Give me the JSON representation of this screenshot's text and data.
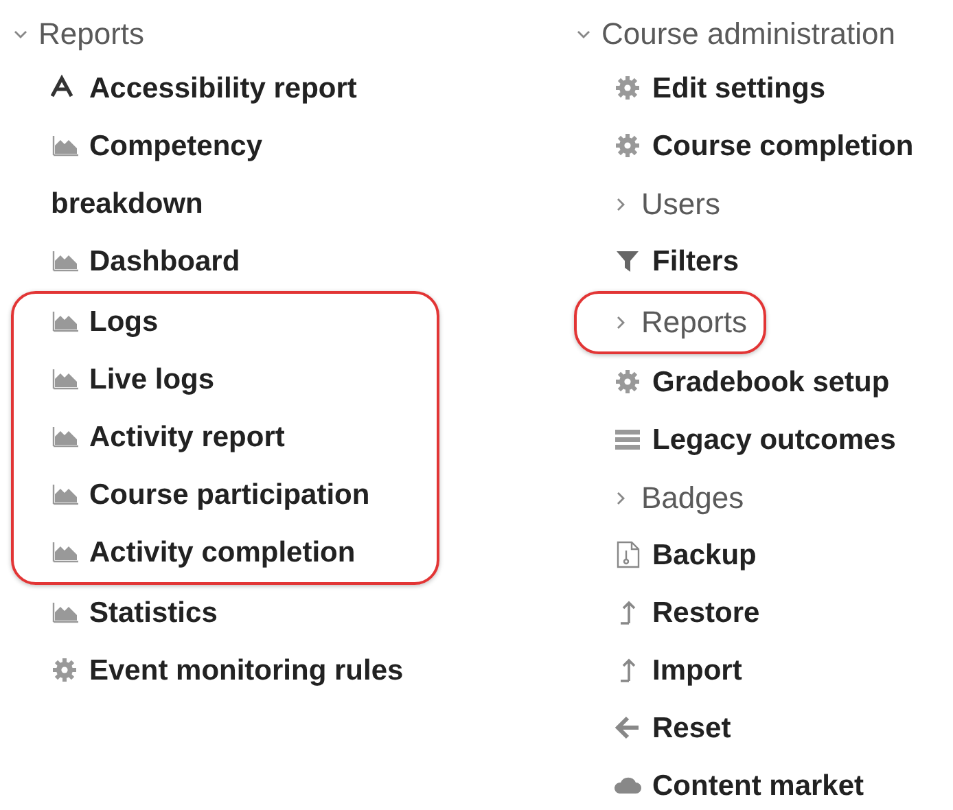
{
  "columns": [
    {
      "header": {
        "label": "Reports",
        "expanded": true
      },
      "groups": [
        {
          "highlighted": false,
          "items": [
            {
              "kind": "accessibility",
              "label": "Accessibility report"
            },
            {
              "kind": "chart",
              "label": "Competency breakdown"
            },
            {
              "kind": "chart",
              "label": "Dashboard"
            }
          ]
        },
        {
          "highlighted": true,
          "items": [
            {
              "kind": "chart",
              "label": "Logs"
            },
            {
              "kind": "chart",
              "label": "Live logs"
            },
            {
              "kind": "chart",
              "label": "Activity report"
            },
            {
              "kind": "chart",
              "label": "Course participation"
            },
            {
              "kind": "chart",
              "label": "Activity completion"
            }
          ]
        },
        {
          "highlighted": false,
          "items": [
            {
              "kind": "chart",
              "label": "Statistics"
            },
            {
              "kind": "gear",
              "label": "Event monitoring rules"
            }
          ]
        }
      ]
    },
    {
      "header": {
        "label": "Course administration",
        "expanded": true
      },
      "groups": [
        {
          "highlighted": false,
          "items": [
            {
              "kind": "gear",
              "label": "Edit settings"
            },
            {
              "kind": "gear",
              "label": "Course completion"
            },
            {
              "kind": "branch",
              "label": "Users",
              "expanded": false
            },
            {
              "kind": "filter",
              "label": "Filters"
            }
          ]
        },
        {
          "highlighted": true,
          "items": [
            {
              "kind": "branch",
              "label": "Reports",
              "expanded": false
            }
          ]
        },
        {
          "highlighted": false,
          "items": [
            {
              "kind": "gear",
              "label": "Gradebook setup"
            },
            {
              "kind": "list",
              "label": "Legacy outcomes"
            },
            {
              "kind": "branch",
              "label": "Badges",
              "expanded": false
            },
            {
              "kind": "file",
              "label": "Backup"
            },
            {
              "kind": "upload",
              "label": "Restore"
            },
            {
              "kind": "upload",
              "label": "Import"
            },
            {
              "kind": "arrow",
              "label": "Reset"
            },
            {
              "kind": "cloud",
              "label": "Content market"
            }
          ]
        }
      ]
    }
  ]
}
